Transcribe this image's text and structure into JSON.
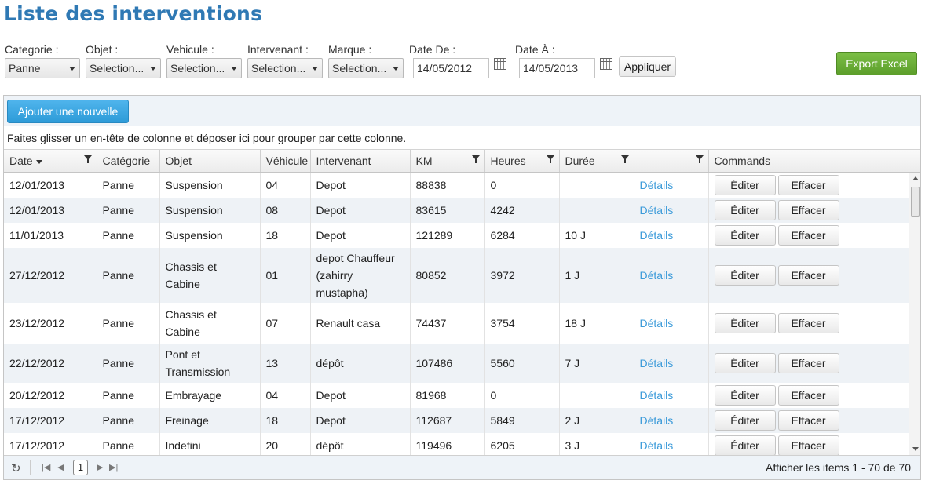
{
  "page": {
    "title": "Liste des interventions"
  },
  "filters": {
    "categorie": {
      "label": "Categorie :",
      "value": "Panne"
    },
    "objet": {
      "label": "Objet :",
      "value": "Selection..."
    },
    "vehicule": {
      "label": "Vehicule :",
      "value": "Selection..."
    },
    "intervenant": {
      "label": "Intervenant :",
      "value": "Selection..."
    },
    "marque": {
      "label": "Marque :",
      "value": "Selection..."
    },
    "date_de": {
      "label": "Date De :",
      "value": "14/05/2012"
    },
    "date_a": {
      "label": "Date À :",
      "value": "14/05/2013"
    },
    "apply_label": "Appliquer",
    "export_label": "Export Excel"
  },
  "grid": {
    "add_label": "Ajouter une nouvelle",
    "group_hint": "Faites glisser un en-tête de colonne et déposer ici pour grouper par cette colonne.",
    "columns": {
      "date": "Date",
      "categorie": "Catégorie",
      "objet": "Objet",
      "vehicule": "Véhicule",
      "intervenant": "Intervenant",
      "km": "KM",
      "heures": "Heures",
      "duree": "Durée",
      "blank": "",
      "commands": "Commands"
    },
    "rows": [
      {
        "date": "12/01/2013",
        "categorie": "Panne",
        "objet": "Suspension",
        "vehicule": "04",
        "intervenant": "Depot",
        "km": "88838",
        "heures": "0",
        "duree": "",
        "details": "Détails",
        "edit": "Éditer",
        "delete": "Effacer"
      },
      {
        "date": "12/01/2013",
        "categorie": "Panne",
        "objet": "Suspension",
        "vehicule": "08",
        "intervenant": "Depot",
        "km": "83615",
        "heures": "4242",
        "duree": "",
        "details": "Détails",
        "edit": "Éditer",
        "delete": "Effacer"
      },
      {
        "date": "11/01/2013",
        "categorie": "Panne",
        "objet": "Suspension",
        "vehicule": "18",
        "intervenant": "Depot",
        "km": "121289",
        "heures": "6284",
        "duree": "10 J",
        "details": "Détails",
        "edit": "Éditer",
        "delete": "Effacer"
      },
      {
        "date": "27/12/2012",
        "categorie": "Panne",
        "objet": "Chassis et Cabine",
        "vehicule": "01",
        "intervenant": "depot Chauffeur (zahirry mustapha)",
        "km": "80852",
        "heures": "3972",
        "duree": "1 J",
        "details": "Détails",
        "edit": "Éditer",
        "delete": "Effacer"
      },
      {
        "date": "23/12/2012",
        "categorie": "Panne",
        "objet": "Chassis et Cabine",
        "vehicule": "07",
        "intervenant": "Renault casa",
        "km": "74437",
        "heures": "3754",
        "duree": "18 J",
        "details": "Détails",
        "edit": "Éditer",
        "delete": "Effacer"
      },
      {
        "date": "22/12/2012",
        "categorie": "Panne",
        "objet": "Pont et Transmission",
        "vehicule": "13",
        "intervenant": "dépôt",
        "km": "107486",
        "heures": "5560",
        "duree": "7 J",
        "details": "Détails",
        "edit": "Éditer",
        "delete": "Effacer"
      },
      {
        "date": "20/12/2012",
        "categorie": "Panne",
        "objet": "Embrayage",
        "vehicule": "04",
        "intervenant": "Depot",
        "km": "81968",
        "heures": "0",
        "duree": "",
        "details": "Détails",
        "edit": "Éditer",
        "delete": "Effacer"
      },
      {
        "date": "17/12/2012",
        "categorie": "Panne",
        "objet": "Freinage",
        "vehicule": "18",
        "intervenant": "Depot",
        "km": "112687",
        "heures": "5849",
        "duree": "2 J",
        "details": "Détails",
        "edit": "Éditer",
        "delete": "Effacer"
      },
      {
        "date": "17/12/2012",
        "categorie": "Panne",
        "objet": "Indefini",
        "vehicule": "20",
        "intervenant": "dépôt",
        "km": "119496",
        "heures": "6205",
        "duree": "3 J",
        "details": "Détails",
        "edit": "Éditer",
        "delete": "Effacer"
      }
    ]
  },
  "pager": {
    "current_page": "1",
    "info": "Afficher les items 1 - 70 de 70"
  },
  "colors": {
    "title": "#2f79b4",
    "export": "#5c9e2b",
    "add": "#2d9bd8",
    "link": "#3a9ad9"
  }
}
